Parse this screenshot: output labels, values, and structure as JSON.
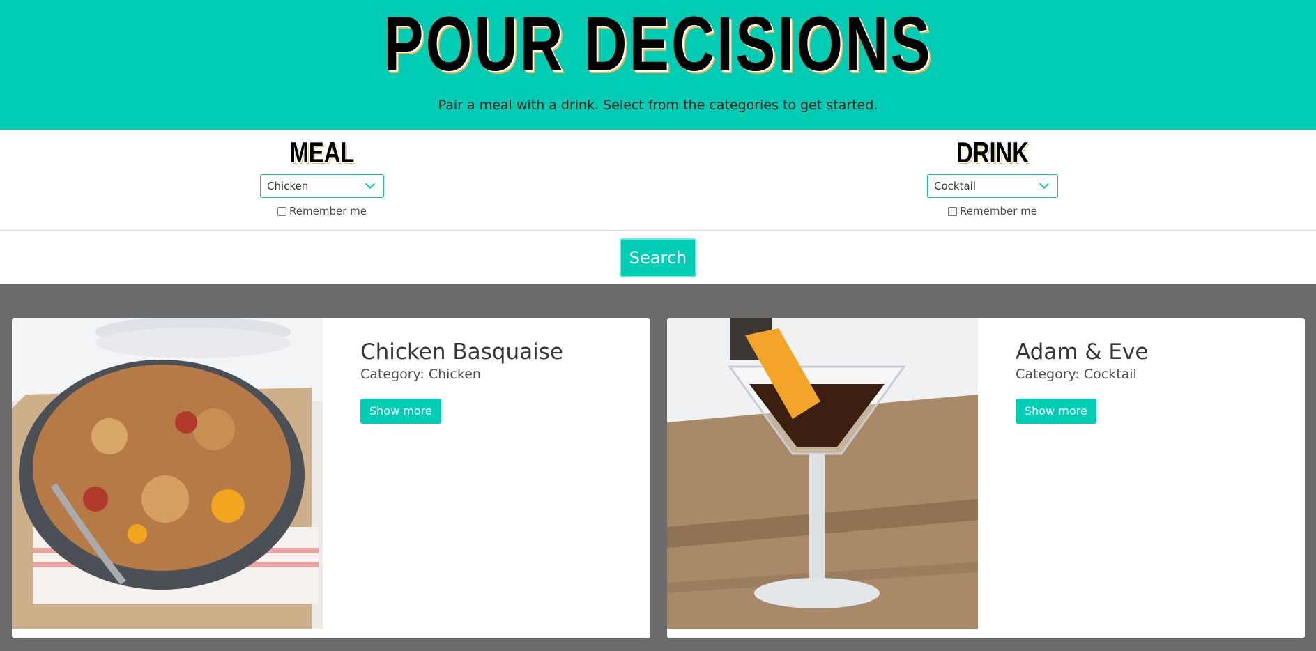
{
  "header": {
    "title": "POUR DECISIONS",
    "subtitle": "Pair a meal with a drink. Select from the categories to get started."
  },
  "meal": {
    "label": "MEAL",
    "selected": "Chicken",
    "remember_label": "Remember me"
  },
  "drink": {
    "label": "DRINK",
    "selected": "Cocktail",
    "remember_label": "Remember me"
  },
  "search": {
    "label": "Search"
  },
  "results": [
    {
      "title": "Chicken Basquaise",
      "category": "Category: Chicken",
      "button": "Show more"
    },
    {
      "title": "Adam & Eve",
      "category": "Category: Cocktail",
      "button": "Show more"
    }
  ],
  "colors": {
    "accent": "#00cdb3",
    "results_bg": "#6b6b6b"
  }
}
